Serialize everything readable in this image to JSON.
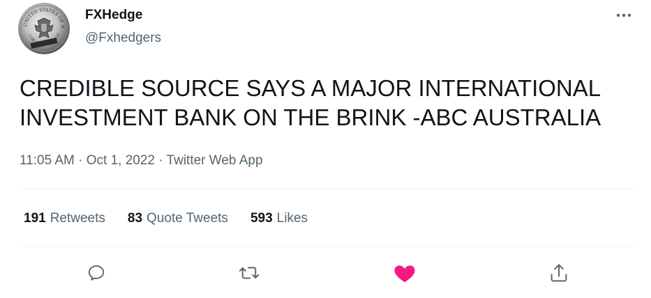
{
  "author": {
    "display_name": "FXHedge",
    "handle": "@Fxhedgers",
    "avatar_icon": "silver-eagle-coin-avatar",
    "avatar_coin_text_top": "UNITED STATES OF AMERICA",
    "avatar_coin_text_bottom": "1 OZ. FINE SILVER~ONE DOLLAR"
  },
  "tweet": {
    "text": "CREDIBLE SOURCE SAYS A MAJOR INTERNATIONAL INVESTMENT BANK ON THE BRINK -ABC AUSTRALIA",
    "time": "11:05 AM",
    "separator": "·",
    "date": "Oct 1, 2022",
    "source": "Twitter Web App"
  },
  "stats": [
    {
      "count": "191",
      "label": "Retweets"
    },
    {
      "count": "83",
      "label": "Quote Tweets"
    },
    {
      "count": "593",
      "label": "Likes"
    }
  ],
  "actions": {
    "reply_icon": "reply-icon",
    "retweet_icon": "retweet-icon",
    "like_icon": "heart-filled-icon",
    "share_icon": "share-icon"
  },
  "colors": {
    "text_primary": "#0f1419",
    "text_secondary": "#536471",
    "like_active": "#f91880",
    "divider": "#eff3f4"
  }
}
